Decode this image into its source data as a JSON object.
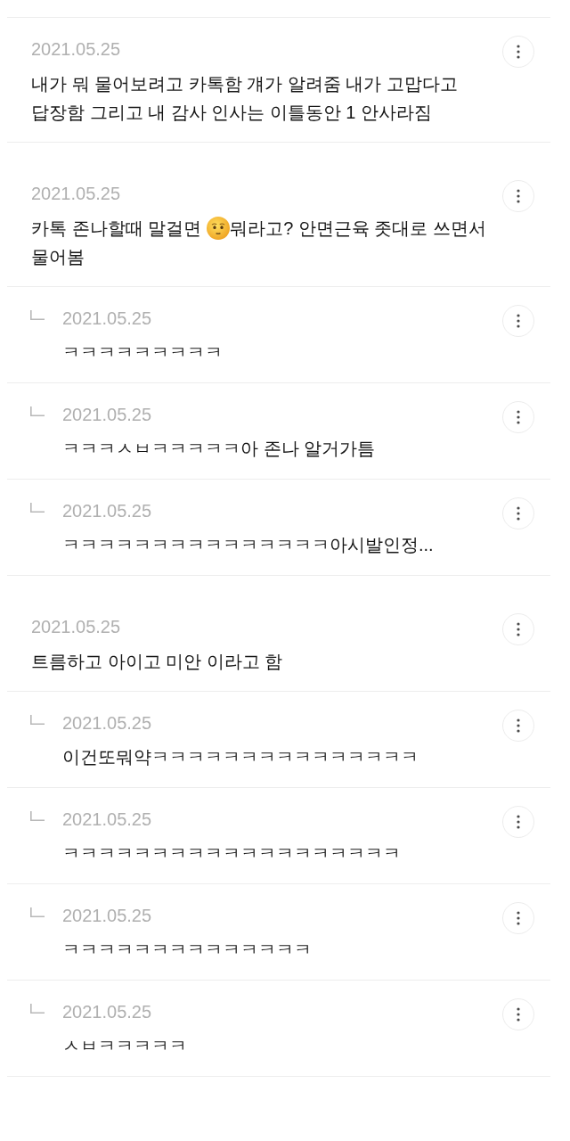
{
  "comments": [
    {
      "date": "2021.05.25",
      "text": "내가 뭐 물어보려고 카톡함 걔가 알려줌 내가 고맙다고 답장함 그리고 내 감사 인사는 이틀동안 1 안사라짐"
    },
    {
      "date": "2021.05.25",
      "parts": [
        {
          "kind": "text",
          "text": "카톡 존나할때 말걸면"
        },
        {
          "kind": "emoji"
        },
        {
          "kind": "text",
          "text": "뭐라고? 안면근육 좃대로 쓰면서 물어봄"
        }
      ],
      "replies": [
        {
          "date": "2021.05.25",
          "text": "ㅋㅋㅋㅋㅋㅋㅋㅋㅋ"
        },
        {
          "date": "2021.05.25",
          "text": "ㅋㅋㅋㅅㅂㅋㅋㅋㅋㅋ아 존나 알거가틈"
        },
        {
          "date": "2021.05.25",
          "text": "ㅋㅋㅋㅋㅋㅋㅋㅋㅋㅋㅋㅋㅋㅋㅋ아시발인정..."
        }
      ]
    },
    {
      "date": "2021.05.25",
      "text": "트름하고 아이고 미안 이라고 함",
      "replies": [
        {
          "date": "2021.05.25",
          "text": "이건또뭐약ㅋㅋㅋㅋㅋㅋㅋㅋㅋㅋㅋㅋㅋㅋㅋ"
        },
        {
          "date": "2021.05.25",
          "text": "ㅋㅋㅋㅋㅋㅋㅋㅋㅋㅋㅋㅋㅋㅋㅋㅋㅋㅋㅋ"
        },
        {
          "date": "2021.05.25",
          "text": "ㅋㅋㅋㅋㅋㅋㅋㅋㅋㅋㅋㅋㅋㅋ"
        },
        {
          "date": "2021.05.25",
          "text": "ㅅㅂㅋㅋㅋㅋㅋ"
        }
      ]
    }
  ]
}
